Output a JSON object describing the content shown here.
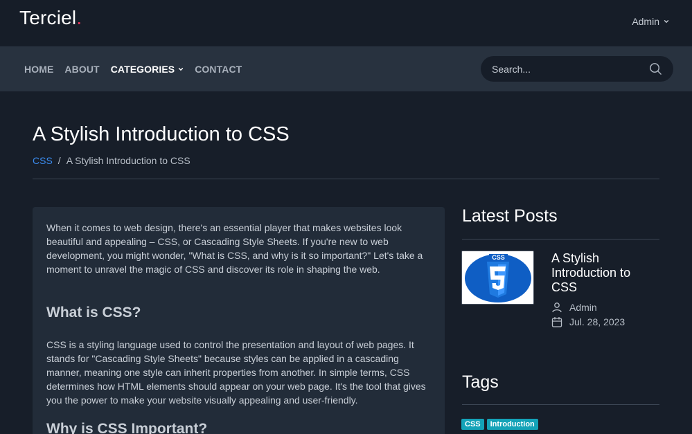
{
  "brand": {
    "name": "Terciel",
    "dot": "."
  },
  "user_menu": {
    "label": "Admin"
  },
  "nav": {
    "items": [
      {
        "label": "HOME"
      },
      {
        "label": "ABOUT"
      },
      {
        "label": "CATEGORIES"
      },
      {
        "label": "CONTACT"
      }
    ]
  },
  "search": {
    "placeholder": "Search..."
  },
  "page": {
    "title": "A Stylish Introduction to CSS",
    "breadcrumb": {
      "category": "CSS",
      "separator": "/",
      "current": "A Stylish Introduction to CSS"
    }
  },
  "article": {
    "intro": "When it comes to web design, there's an essential player that makes websites look beautiful and appealing – CSS, or Cascading Style Sheets. If you're new to web development, you might wonder, \"What is CSS, and why is it so important?\" Let's take a moment to unravel the magic of CSS and discover its role in shaping the web.",
    "heading1": "What is CSS?",
    "para2": "CSS is a styling language used to control the presentation and layout of web pages. It stands for \"Cascading Style Sheets\" because styles can be applied in a cascading manner, meaning one style can inherit properties from another. In simple terms, CSS determines how HTML elements should appear on your web page. It's the tool that gives you the power to make your website visually appealing and user-friendly.",
    "heading2": "Why is CSS Important?"
  },
  "sidebar": {
    "latest_title": "Latest Posts",
    "post": {
      "title": "A Stylish Introduction to CSS",
      "author": "Admin",
      "date": "Jul. 28, 2023",
      "thumb_label": "CSS"
    },
    "tags_title": "Tags",
    "tags": [
      "CSS",
      "Introduction"
    ]
  },
  "colors": {
    "accent": "#e0335a",
    "link": "#3b8cf0",
    "tag": "#14a3b8",
    "background": "#171e29"
  }
}
